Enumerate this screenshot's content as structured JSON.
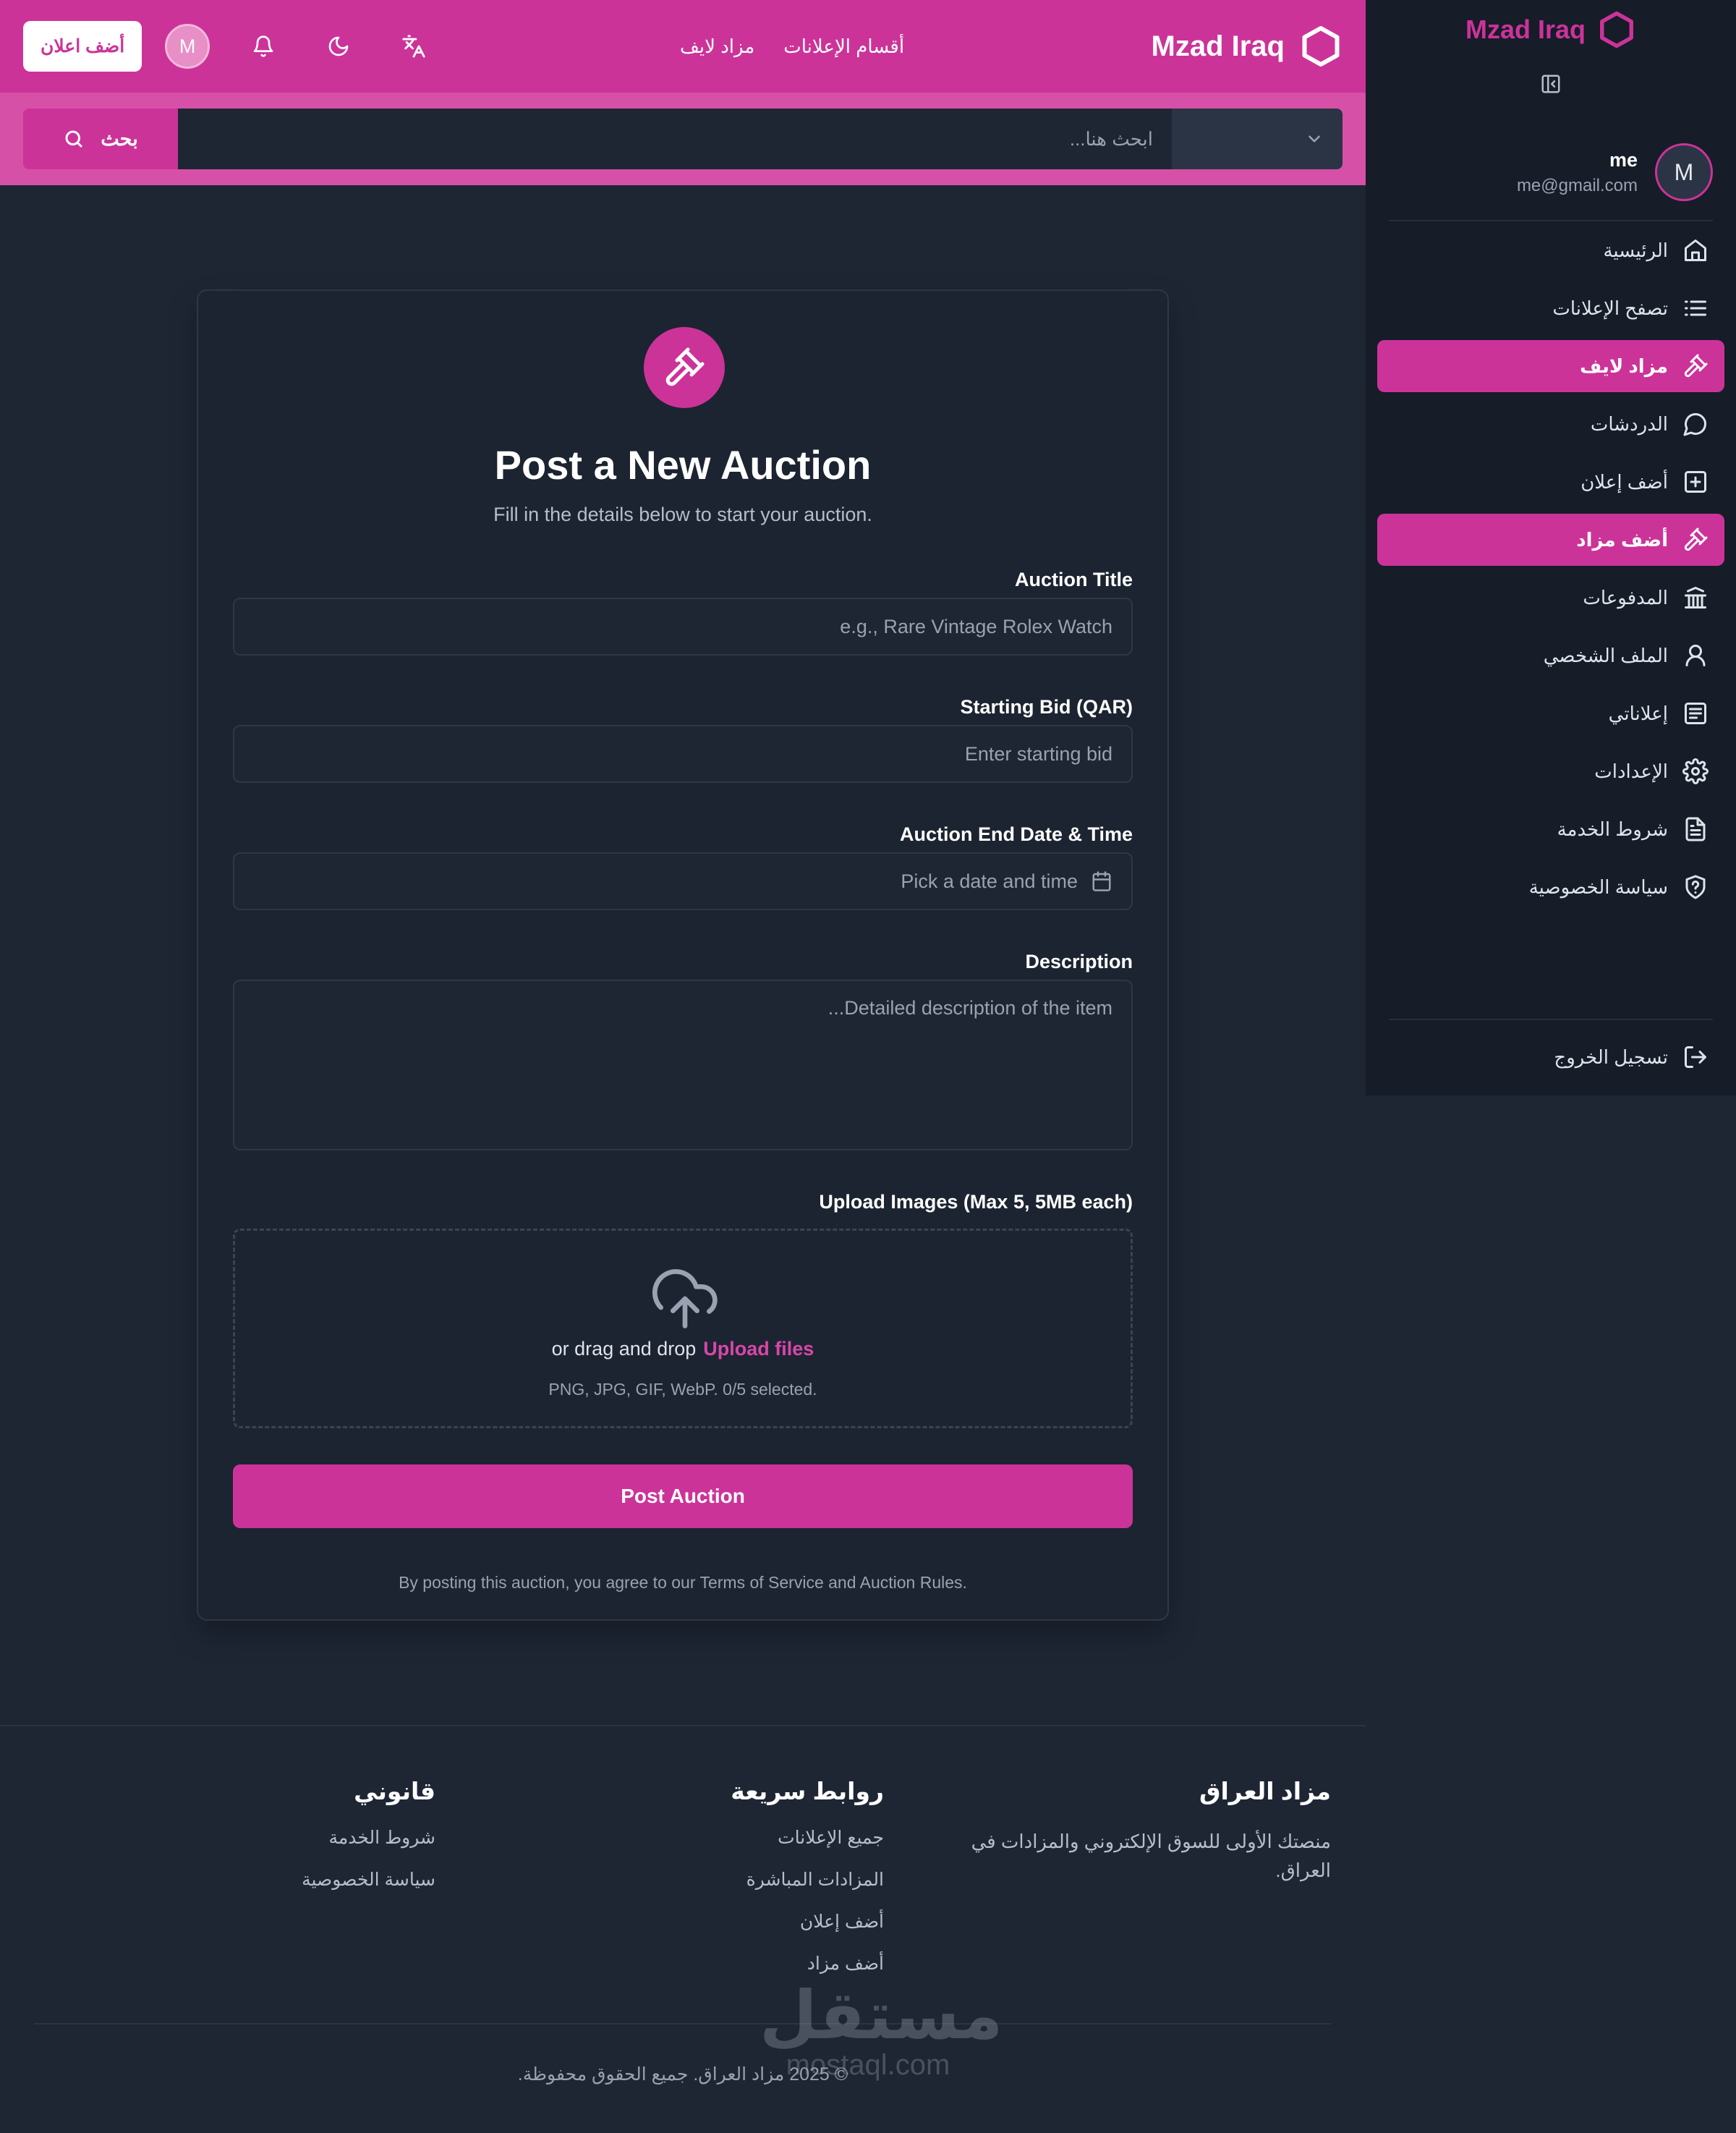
{
  "header": {
    "brand": "Mzad Iraq",
    "nav": [
      "أقسام الإعلانات",
      "مزاد لايف"
    ],
    "add_ad_label": "أضف اعلان",
    "avatar_initial": "M"
  },
  "search": {
    "placeholder": "ابحث هنا...",
    "button_label": "بحث"
  },
  "sidebar": {
    "brand": "Mzad Iraq",
    "user": {
      "name": "me",
      "email": "me@gmail.com",
      "initial": "M"
    },
    "items": [
      {
        "label": "الرئيسية",
        "icon": "home-icon",
        "active": false
      },
      {
        "label": "تصفح الإعلانات",
        "icon": "list-icon",
        "active": false
      },
      {
        "label": "مزاد لايف",
        "icon": "gavel-icon",
        "active": true
      },
      {
        "label": "الدردشات",
        "icon": "chat-icon",
        "active": false
      },
      {
        "label": "أضف إعلان",
        "icon": "plus-square-icon",
        "active": false
      },
      {
        "label": "أضف مزاد",
        "icon": "gavel-icon",
        "active": true
      },
      {
        "label": "المدفوعات",
        "icon": "bank-icon",
        "active": false
      },
      {
        "label": "الملف الشخصي",
        "icon": "user-icon",
        "active": false
      },
      {
        "label": "إعلاناتي",
        "icon": "ads-icon",
        "active": false
      },
      {
        "label": "الإعدادات",
        "icon": "gear-icon",
        "active": false
      },
      {
        "label": "شروط الخدمة",
        "icon": "document-icon",
        "active": false
      },
      {
        "label": "سياسة الخصوصية",
        "icon": "shield-icon",
        "active": false
      }
    ],
    "logout_label": "تسجيل الخروج"
  },
  "form": {
    "title": "Post a New Auction",
    "subtitle": "Fill in the details below to start your auction.",
    "auction_title": {
      "label": "Auction Title",
      "placeholder": "e.g., Rare Vintage Rolex Watch"
    },
    "starting_bid": {
      "label": "Starting Bid (QAR)",
      "placeholder": "Enter starting bid"
    },
    "end_date": {
      "label": "Auction End Date & Time",
      "placeholder": "Pick a date and time"
    },
    "description": {
      "label": "Description",
      "placeholder": "Detailed description of the item..."
    },
    "upload": {
      "label": "Upload Images (Max 5, 5MB each)",
      "link_label": "Upload files",
      "drag_text": "or drag and drop",
      "hint": "PNG, JPG, GIF, WebP. 0/5 selected."
    },
    "submit_label": "Post Auction",
    "note": "By posting this auction, you agree to our Terms of Service and Auction Rules."
  },
  "footer": {
    "about": {
      "title": "مزاد العراق",
      "text": "منصتك الأولى للسوق الإلكتروني والمزادات في العراق."
    },
    "quick_links": {
      "title": "روابط سريعة",
      "links": [
        "جميع الإعلانات",
        "المزادات المباشرة",
        "أضف إعلان",
        "أضف مزاد"
      ]
    },
    "legal": {
      "title": "قانوني",
      "links": [
        "شروط الخدمة",
        "سياسة الخصوصية"
      ]
    },
    "copyright": "© 2025 مزاد العراق. جميع الحقوق محفوظة."
  },
  "watermark": {
    "arabic": "مستقل",
    "latin": "mostaql.com"
  },
  "colors": {
    "accent": "#cc3399",
    "background": "#1e2634",
    "sidebar": "#161c28"
  }
}
